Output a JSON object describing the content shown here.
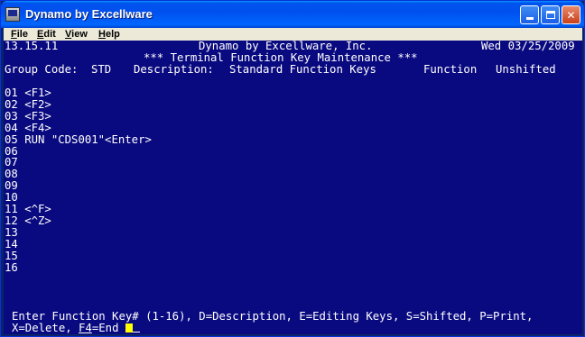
{
  "window": {
    "title": "Dynamo by Excellware"
  },
  "menu": {
    "items": [
      {
        "label": "File",
        "accel": "F",
        "rest": "ile"
      },
      {
        "label": "Edit",
        "accel": "E",
        "rest": "dit"
      },
      {
        "label": "View",
        "accel": "V",
        "rest": "iew"
      },
      {
        "label": "Help",
        "accel": "H",
        "rest": "elp"
      }
    ]
  },
  "terminal": {
    "version": "13.15.11",
    "company": "Dynamo by Excellware, Inc.",
    "date": "Wed 03/25/2009",
    "screen_title": "*** Terminal Function Key Maintenance ***",
    "group_code_label": "Group Code:",
    "group_code": "STD",
    "description_label": "Description:",
    "description": "Standard Function Keys",
    "function_label": "Function",
    "shift_state": "Unshifted",
    "keys": [
      {
        "num": "01",
        "value": "<F1>"
      },
      {
        "num": "02",
        "value": "<F2>"
      },
      {
        "num": "03",
        "value": "<F3>"
      },
      {
        "num": "04",
        "value": "<F4>"
      },
      {
        "num": "05",
        "value": "RUN \"CDS001\"<Enter>"
      },
      {
        "num": "06",
        "value": ""
      },
      {
        "num": "07",
        "value": ""
      },
      {
        "num": "08",
        "value": ""
      },
      {
        "num": "09",
        "value": ""
      },
      {
        "num": "10",
        "value": ""
      },
      {
        "num": "11",
        "value": "<^F>"
      },
      {
        "num": "12",
        "value": "<^Z>"
      },
      {
        "num": "13",
        "value": ""
      },
      {
        "num": "14",
        "value": ""
      },
      {
        "num": "15",
        "value": ""
      },
      {
        "num": "16",
        "value": ""
      }
    ],
    "prompt_line1": "Enter Function Key# (1-16), D=Description, E=Editing Keys, S=Shifted, P=Print,",
    "prompt_line2_a": "X=Delete, ",
    "prompt_line2_key": "F4",
    "prompt_line2_b": "=End "
  }
}
